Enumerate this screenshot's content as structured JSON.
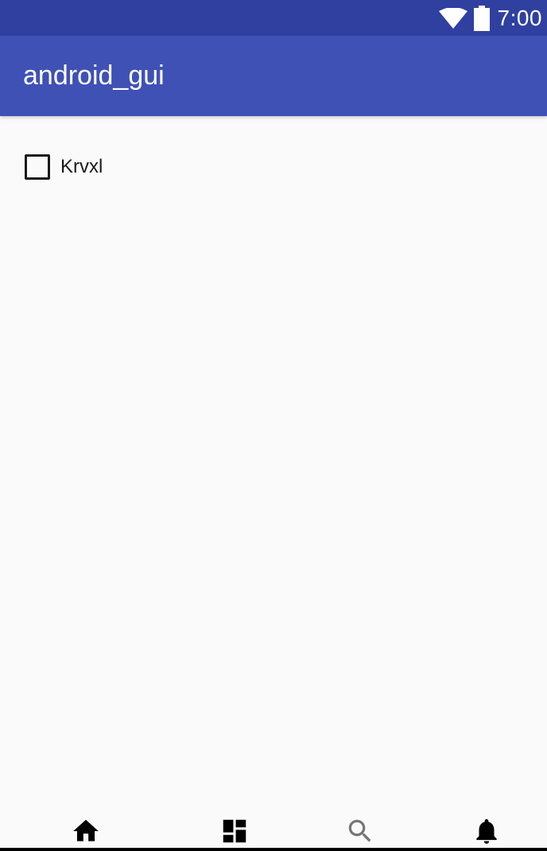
{
  "status_bar": {
    "time": "7:00",
    "icons": [
      "wifi-icon",
      "battery-icon"
    ],
    "color": "#3040a0"
  },
  "app_bar": {
    "title": "android_gui",
    "color": "#3f51b5"
  },
  "content": {
    "checkbox": {
      "label": "Krvxl",
      "checked": false
    }
  },
  "bottom_nav": {
    "items": [
      {
        "icon": "home-icon",
        "selected": true
      },
      {
        "icon": "dashboard-icon",
        "selected": false
      },
      {
        "icon": "search-icon",
        "selected": false
      },
      {
        "icon": "notifications-icon",
        "selected": false
      }
    ]
  }
}
